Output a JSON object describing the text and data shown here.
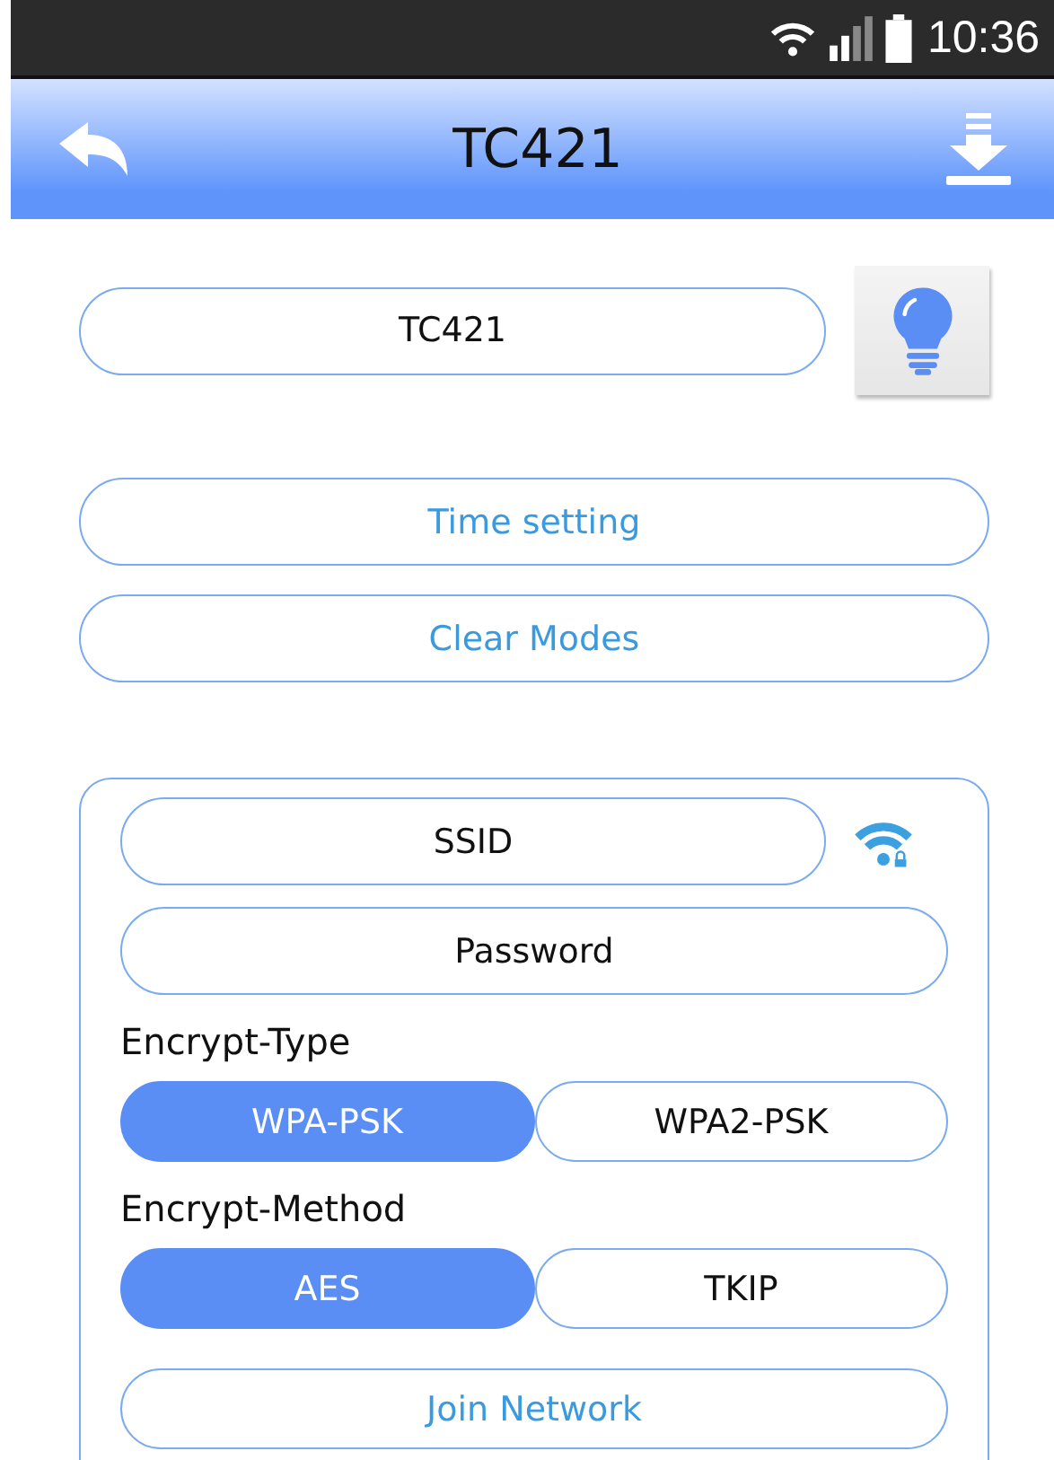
{
  "status_bar": {
    "time": "10:36"
  },
  "header": {
    "title": "TC421"
  },
  "device_name": {
    "value": "TC421"
  },
  "actions": [
    "Time setting",
    "Clear Modes"
  ],
  "wifi": {
    "ssid_placeholder": "SSID",
    "password_placeholder": "Password",
    "groups": [
      {
        "label": "Encrypt-Type",
        "options": [
          {
            "label": "WPA-PSK",
            "selected": true
          },
          {
            "label": "WPA2-PSK",
            "selected": false
          }
        ]
      },
      {
        "label": "Encrypt-Method",
        "options": [
          {
            "label": "AES",
            "selected": true
          },
          {
            "label": "TKIP",
            "selected": false
          }
        ]
      }
    ],
    "join_button": "Join Network"
  }
}
